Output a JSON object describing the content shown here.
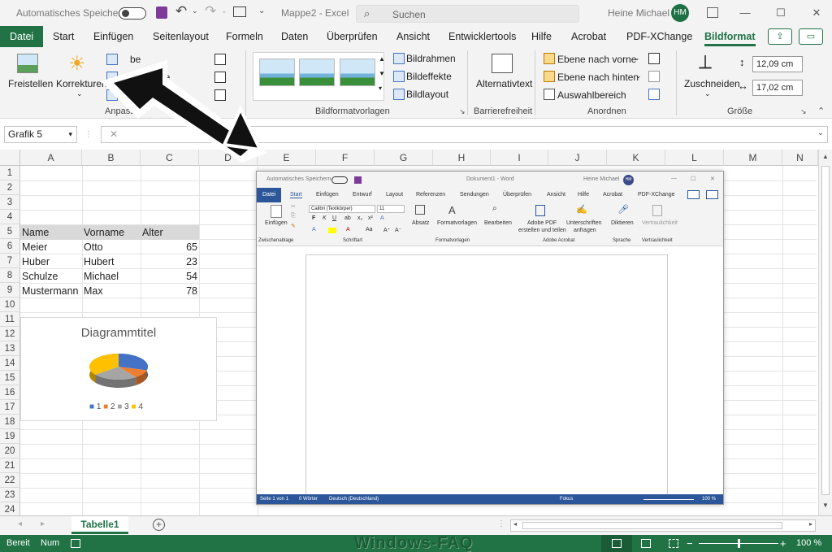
{
  "titlebar": {
    "autosave_label": "Automatisches Speichern",
    "doc_title": "Mappe2  -  Excel",
    "search_placeholder": "Suchen",
    "user_name": "Heine Michael",
    "user_initials": "HM"
  },
  "tabs": [
    "Datei",
    "Start",
    "Einfügen",
    "Seitenlayout",
    "Formeln",
    "Daten",
    "Überprüfen",
    "Ansicht",
    "Entwicklertools",
    "Hilfe",
    "Acrobat",
    "PDF-XChange",
    "Bildformat"
  ],
  "ribbon": {
    "freistellen": "Freistellen",
    "korrekturen": "Korrekturen",
    "farbe": "be",
    "effekte": "he",
    "group_anpassen": "Anpassen",
    "bildrahmen": "Bildrahmen",
    "bildeffekte": "Bildeffekte",
    "bildlayout": "Bildlayout",
    "group_bildformatvorlagen": "Bildformatvorlagen",
    "alternativtext": "Alternativtext",
    "group_barrierefreiheit": "Barrierefreiheit",
    "ebene_vorne": "Ebene nach vorne",
    "ebene_hinten": "Ebene nach hinten",
    "auswahlbereich": "Auswahlbereich",
    "group_anordnen": "Anordnen",
    "zuschneiden": "Zuschneiden",
    "height_value": "12,09 cm",
    "width_value": "17,02 cm",
    "group_groesse": "Größe"
  },
  "formula_bar": {
    "name_box": "Grafik 5"
  },
  "columns": [
    "A",
    "B",
    "C",
    "D",
    "E",
    "F",
    "G",
    "H",
    "I",
    "J",
    "K",
    "L",
    "M",
    "N"
  ],
  "rows": [
    "1",
    "2",
    "3",
    "4",
    "5",
    "6",
    "7",
    "8",
    "9",
    "10",
    "11",
    "12",
    "13",
    "14",
    "15",
    "16",
    "17",
    "18",
    "19",
    "20",
    "21",
    "22",
    "23",
    "24"
  ],
  "table": {
    "headers": [
      "Name",
      "Vorname",
      "Alter"
    ],
    "data": [
      [
        "Meier",
        "Otto",
        "65"
      ],
      [
        "Huber",
        "Hubert",
        "23"
      ],
      [
        "Schulze",
        "Michael",
        "54"
      ],
      [
        "Mustermann",
        "Max",
        "78"
      ]
    ]
  },
  "chart_data": {
    "type": "pie",
    "title": "Diagrammtitel",
    "categories": [
      "1",
      "2",
      "3",
      "4"
    ],
    "values": [
      65,
      23,
      54,
      78
    ],
    "colors": [
      "#4472c4",
      "#ed7d31",
      "#a5a5a5",
      "#ffc000"
    ],
    "legend": "bottom"
  },
  "word": {
    "autosave": "Automatisches Speichern",
    "title": "Dokument1  -  Word",
    "user": "Heine Michael",
    "initials": "HM",
    "tabs": [
      "Datei",
      "Start",
      "Einfügen",
      "Entwurf",
      "Layout",
      "Referenzen",
      "Sendungen",
      "Überprüfen",
      "Ansicht",
      "Hilfe",
      "Acrobat",
      "PDF-XChange"
    ],
    "einfuegen": "Einfügen",
    "font_name": "Calibri (Textkörper)",
    "font_size": "11",
    "absatz": "Absatz",
    "formatvorlagen": "Formatvorlagen",
    "bearbeiten": "Bearbeiten",
    "adobe_pdf_1": "Adobe PDF",
    "adobe_pdf_2": "erstellen und teilen",
    "unterschriften_1": "Unterschriften",
    "unterschriften_2": "anfragen",
    "diktieren": "Diktieren",
    "vertraulichkeit": "Vertraulichkeit",
    "groups": [
      "Zwischenablage",
      "Schriftart",
      "Formatvorlagen",
      "Adobe Acrobat",
      "Sprache",
      "Vertraulichkeit"
    ],
    "status_page": "Seite 1 von 1",
    "status_words": "0 Wörter",
    "status_lang": "Deutsch (Deutschland)",
    "status_focus": "Fokus",
    "status_zoom": "100 %"
  },
  "sheet_tab": "Tabelle1",
  "status": {
    "ready": "Bereit",
    "num": "Num",
    "zoom": "100 %",
    "watermark": "Windows-FAQ"
  }
}
